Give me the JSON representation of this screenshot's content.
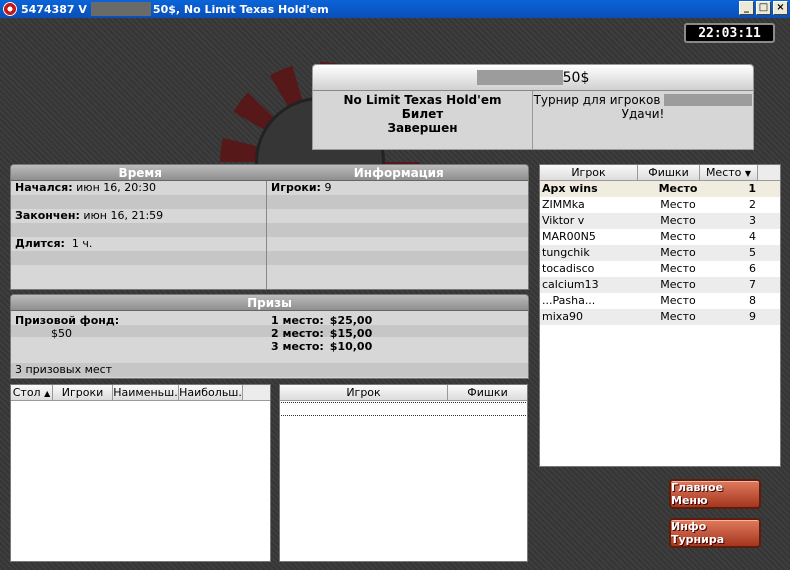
{
  "window": {
    "title_id": "5474387 V",
    "title_rest": " 50$, No Limit Texas Hold'em",
    "buttons": [
      "_",
      "□",
      "×"
    ]
  },
  "clock": "22:03:11",
  "header": {
    "amount": "50$",
    "game": "No Limit Texas Hold'em",
    "ticket": "Билет",
    "status": "Завершен",
    "tournament_for": "Турнир для игроков",
    "good_luck": "Удачи!"
  },
  "time_panel": {
    "time_title": "Время",
    "info_title": "Информация",
    "started_label": "Начался:",
    "started_value": "июн 16, 20:30",
    "ended_label": "Закончен:",
    "ended_value": "июн 16, 21:59",
    "duration_label": "Длится:",
    "duration_value": "1 ч.",
    "players_label": "Игроки:",
    "players_value": "9"
  },
  "prizes": {
    "title": "Призы",
    "fund_label": "Призовой фонд:",
    "fund_value": "$50",
    "count": "3 призовых мест",
    "places": [
      {
        "label": "1 место:",
        "amount": "$25,00"
      },
      {
        "label": "2 место:",
        "amount": "$15,00"
      },
      {
        "label": "3 место:",
        "amount": "$10,00"
      }
    ]
  },
  "tables_list": {
    "columns": [
      "Стол",
      "Игроки",
      "Наименьш.",
      "Наибольш."
    ]
  },
  "players_list": {
    "columns": [
      "Игрок",
      "Фишки"
    ]
  },
  "standings": {
    "columns": [
      "Игрок",
      "Фишки",
      "Место"
    ],
    "rows": [
      {
        "name": "Apx wins",
        "chips": "Место",
        "place": "1"
      },
      {
        "name": "ZIMMka",
        "chips": "Место",
        "place": "2"
      },
      {
        "name": "Viktor v",
        "chips": "Место",
        "place": "3"
      },
      {
        "name": "MAR00N5",
        "chips": "Место",
        "place": "4"
      },
      {
        "name": "tungchik",
        "chips": "Место",
        "place": "5"
      },
      {
        "name": "tocadisco",
        "chips": "Место",
        "place": "6"
      },
      {
        "name": "calcium13",
        "chips": "Место",
        "place": "7"
      },
      {
        "name": "...Pasha...",
        "chips": "Место",
        "place": "8"
      },
      {
        "name": "mixa90",
        "chips": "Место",
        "place": "9"
      }
    ]
  },
  "buttons": {
    "main_menu": "Главное Меню",
    "tournament_info": "Инфо Турнира"
  }
}
